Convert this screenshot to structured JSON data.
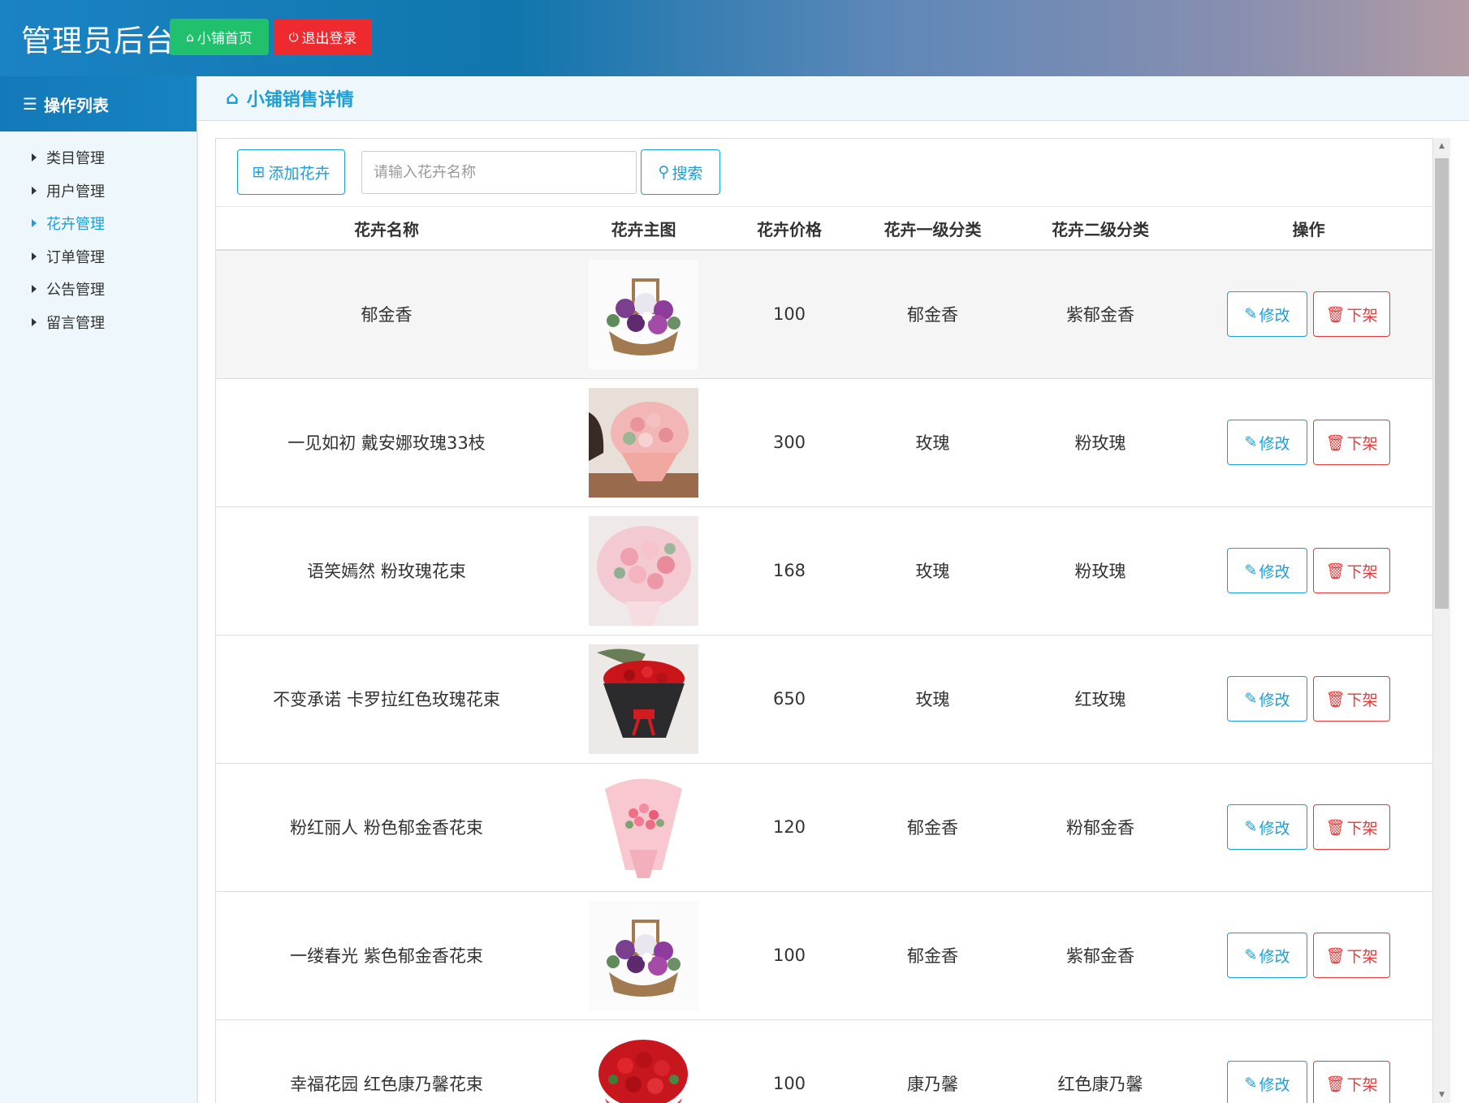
{
  "header": {
    "brand": "管理员后台",
    "home_button": "小铺首页",
    "logout_button": "退出登录"
  },
  "sidebar": {
    "title": "操作列表",
    "items": [
      {
        "label": "类目管理",
        "active": false
      },
      {
        "label": "用户管理",
        "active": false
      },
      {
        "label": "花卉管理",
        "active": true
      },
      {
        "label": "订单管理",
        "active": false
      },
      {
        "label": "公告管理",
        "active": false
      },
      {
        "label": "留言管理",
        "active": false
      }
    ]
  },
  "page": {
    "title": "小铺销售详情"
  },
  "toolbar": {
    "add_button": "添加花卉",
    "search_placeholder": "请输入花卉名称",
    "search_button": "搜索"
  },
  "table": {
    "columns": [
      "花卉名称",
      "花卉主图",
      "花卉价格",
      "花卉一级分类",
      "花卉二级分类",
      "操作"
    ],
    "edit_label": "修改",
    "delete_label": "下架",
    "rows": [
      {
        "name": "郁金香",
        "price": "100",
        "cat1": "郁金香",
        "cat2": "紫郁金香",
        "image": "purple-tulip-basket"
      },
      {
        "name": "一见如初 戴安娜玫瑰33枝",
        "price": "300",
        "cat1": "玫瑰",
        "cat2": "粉玫瑰",
        "image": "pink-rose-bouquet-person"
      },
      {
        "name": "语笑嫣然 粉玫瑰花束",
        "price": "168",
        "cat1": "玫瑰",
        "cat2": "粉玫瑰",
        "image": "pink-rose-bouquet"
      },
      {
        "name": "不变承诺 卡罗拉红色玫瑰花束",
        "price": "650",
        "cat1": "玫瑰",
        "cat2": "红玫瑰",
        "image": "red-rose-black-wrap"
      },
      {
        "name": "粉红丽人 粉色郁金香花束",
        "price": "120",
        "cat1": "郁金香",
        "cat2": "粉郁金香",
        "image": "pink-tulip-bouquet"
      },
      {
        "name": "一缕春光 紫色郁金香花束",
        "price": "100",
        "cat1": "郁金香",
        "cat2": "紫郁金香",
        "image": "purple-tulip-basket"
      },
      {
        "name": "幸福花园 红色康乃馨花束",
        "price": "100",
        "cat1": "康乃馨",
        "cat2": "红色康乃馨",
        "image": "red-carnation-bouquet"
      }
    ]
  },
  "colors": {
    "accent": "#1a9fd9",
    "success": "#21c06d",
    "danger": "#ee2a2f"
  }
}
